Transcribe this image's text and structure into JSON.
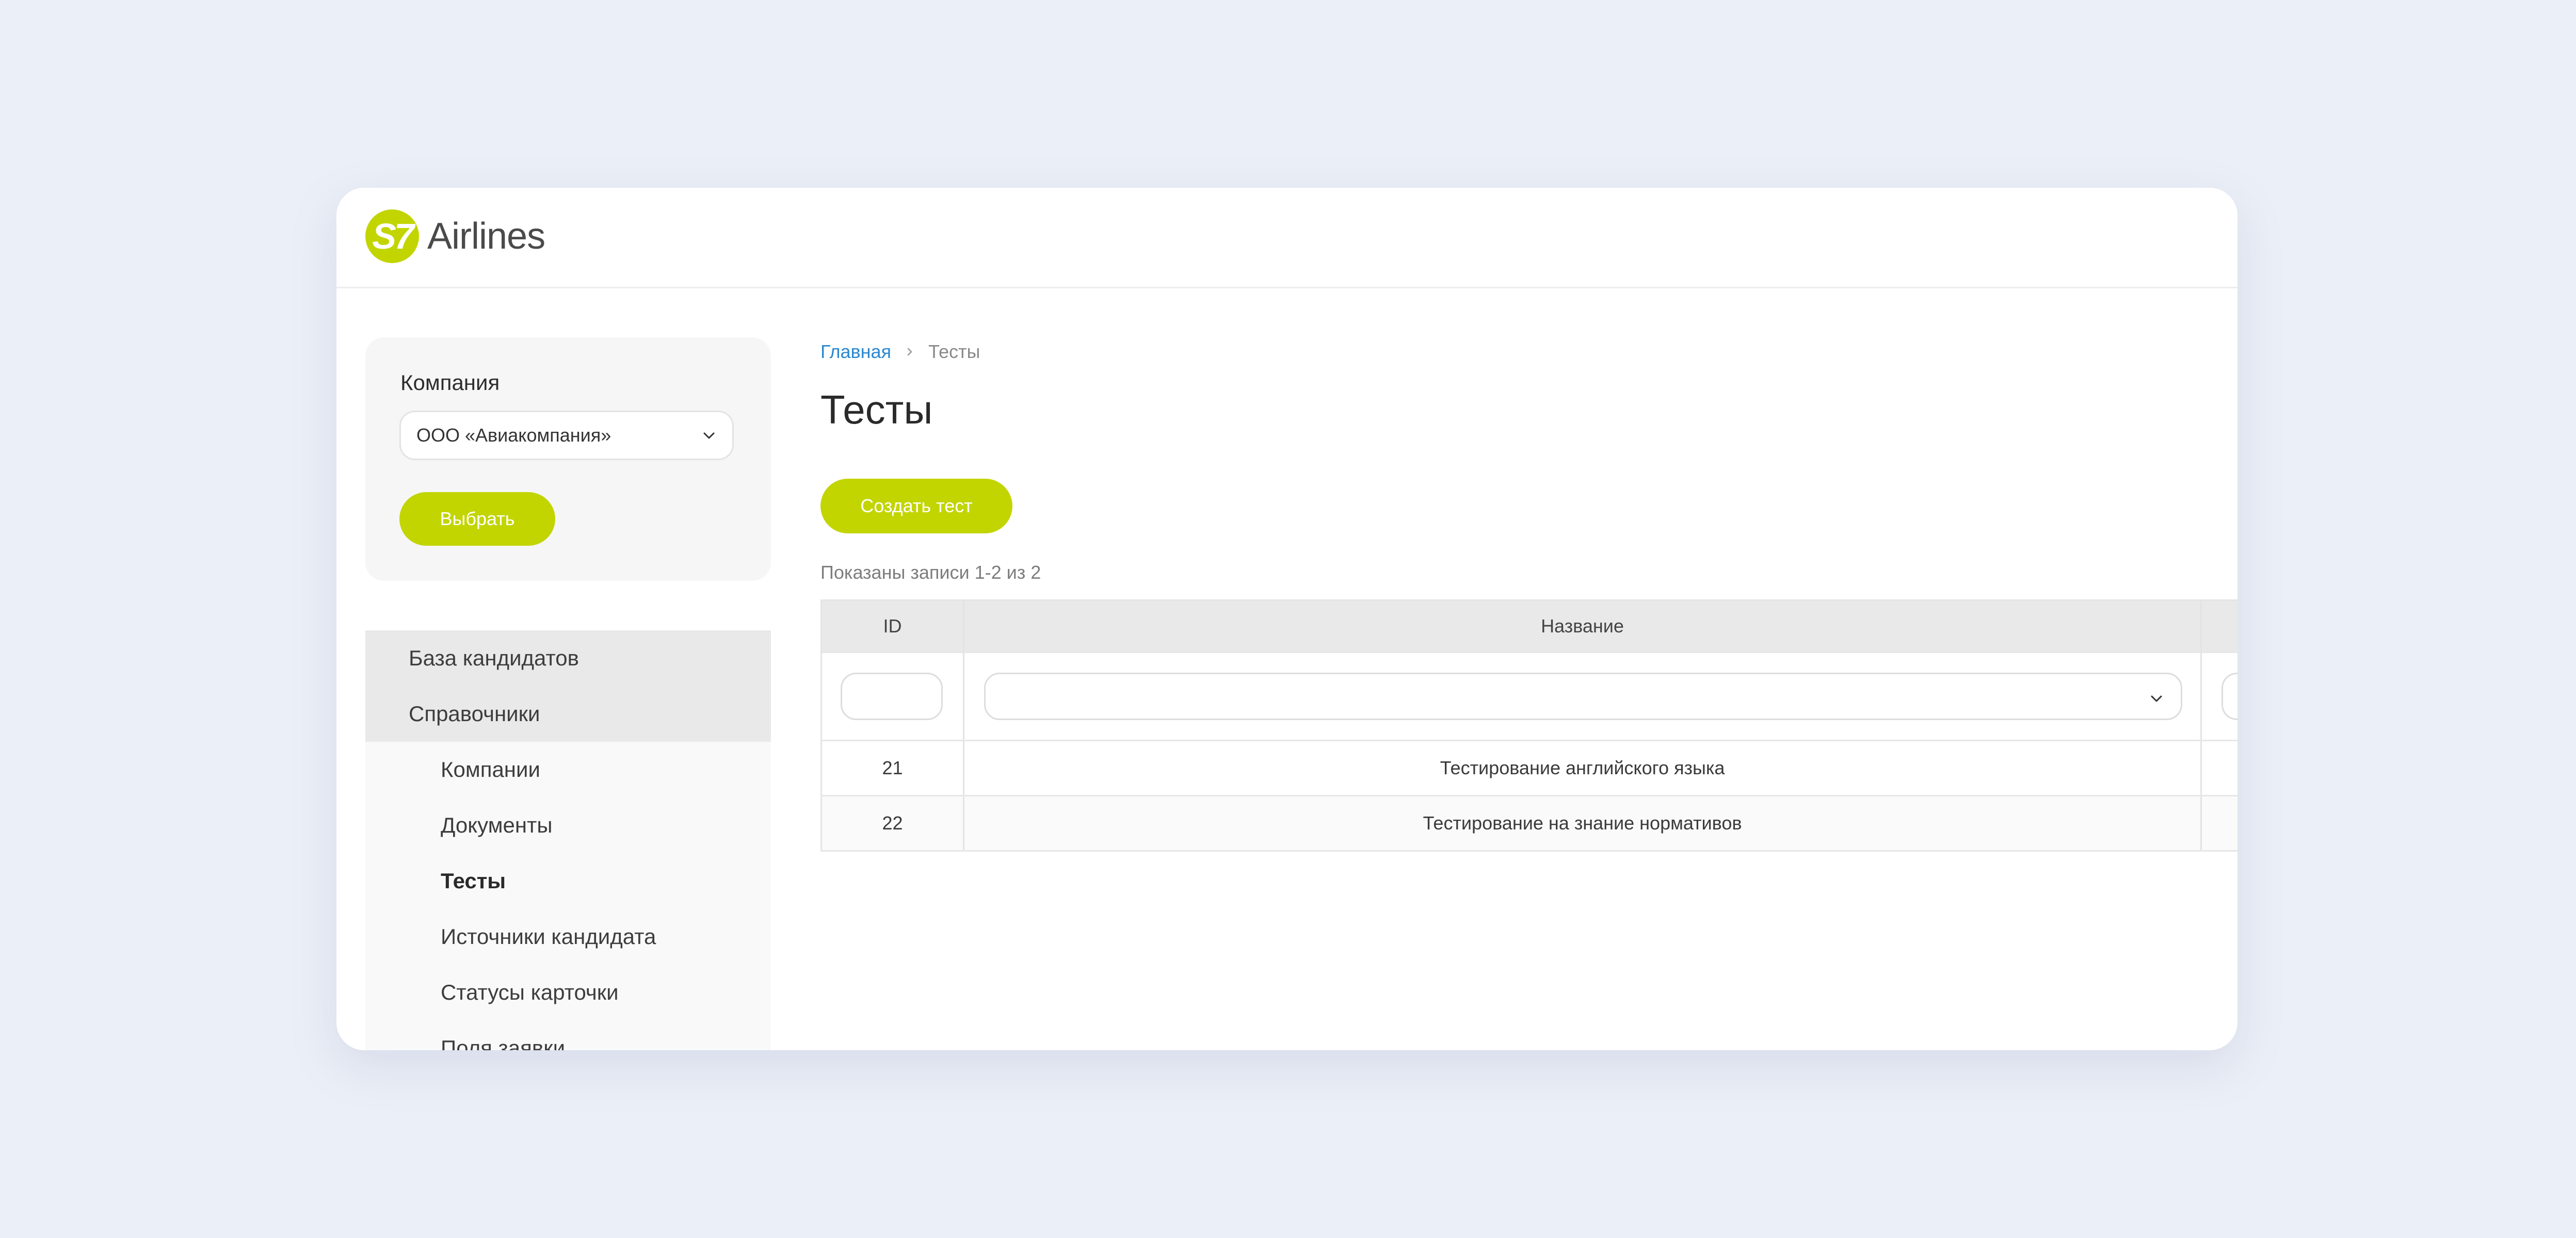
{
  "header": {
    "logo_mark": "S7",
    "logo_text": "Airlines"
  },
  "company_card": {
    "label": "Компания",
    "selected_company": "ООО «Авиакомпания»",
    "choose_button": "Выбрать"
  },
  "nav": {
    "top_items": [
      {
        "label": "База кандидатов"
      },
      {
        "label": "Справочники"
      }
    ],
    "sub_items": [
      {
        "label": "Компании"
      },
      {
        "label": "Документы"
      },
      {
        "label": "Тесты",
        "active": true
      },
      {
        "label": "Источники кандидата"
      },
      {
        "label": "Статусы карточки"
      },
      {
        "label": "Поля заявки"
      }
    ]
  },
  "breadcrumb": {
    "home": "Главная",
    "current": "Тесты"
  },
  "page": {
    "title": "Тесты",
    "create_button": "Создать тест",
    "records_info": "Показаны записи 1-2 из 2"
  },
  "table": {
    "columns": [
      "ID",
      "Название"
    ],
    "rows": [
      {
        "id": "21",
        "name": "Тестирование английского языка"
      },
      {
        "id": "22",
        "name": "Тестирование на знание  нормативов"
      }
    ]
  },
  "colors": {
    "accent": "#C2D500",
    "link": "#2A87D0",
    "background": "#EBEFF7"
  }
}
